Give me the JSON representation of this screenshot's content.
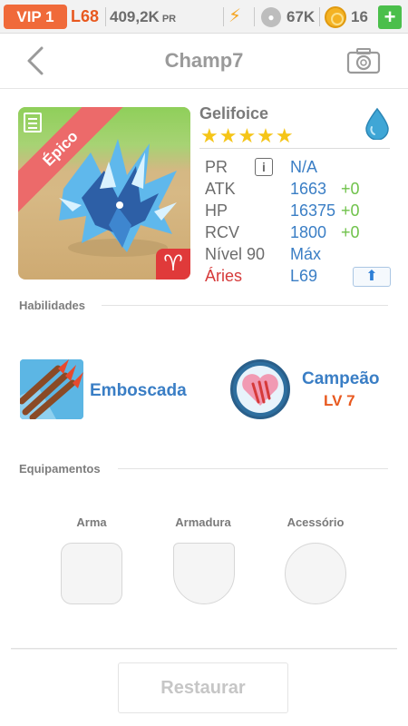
{
  "topbar": {
    "vip": "VIP 1",
    "level": "L68",
    "power": "409,2K",
    "power_unit": "PR",
    "energy_icon": "bolt-icon",
    "food_icon": "food-icon",
    "food": "67K",
    "coin_icon": "coin-icon",
    "coins": "16",
    "plus_label": "+"
  },
  "header": {
    "title": "Champ7",
    "back_icon": "chevron-left-icon",
    "camera_icon": "camera-icon"
  },
  "monster": {
    "rarity": "Épico",
    "name": "Gelifoice",
    "stars": "★★★★★",
    "star_count": 5,
    "element_icon": "water-drop-icon",
    "zodiac_symbol": "♈",
    "stats": [
      {
        "label": "PR",
        "value": "N/A",
        "bonus": ""
      },
      {
        "label": "ATK",
        "value": "1663",
        "bonus": "+0"
      },
      {
        "label": "HP",
        "value": "16375",
        "bonus": "+0"
      },
      {
        "label": "RCV",
        "value": "1800",
        "bonus": "+0"
      },
      {
        "label": "Nível 90",
        "value": "Máx",
        "bonus": ""
      },
      {
        "label": "Áries",
        "value": "L69",
        "bonus": ""
      }
    ],
    "info_btn": "i",
    "upgrade_icon": "⬆"
  },
  "skills": {
    "section_title": "Habilidades",
    "skill1": {
      "name": "Emboscada"
    },
    "skill2": {
      "name": "Campeão",
      "level": "LV 7"
    }
  },
  "equipment": {
    "section_title": "Equipamentos",
    "slots": [
      "Arma",
      "Armadura",
      "Acessório"
    ]
  },
  "restore_label": "Restaurar",
  "colors": {
    "vip_bg": "#f06a3a",
    "level": "#e8591f",
    "accent_blue": "#3a7ec5",
    "bonus_green": "#6fc24a",
    "zodiac_red": "#d63a3a",
    "plus_green": "#4bbf4b"
  }
}
